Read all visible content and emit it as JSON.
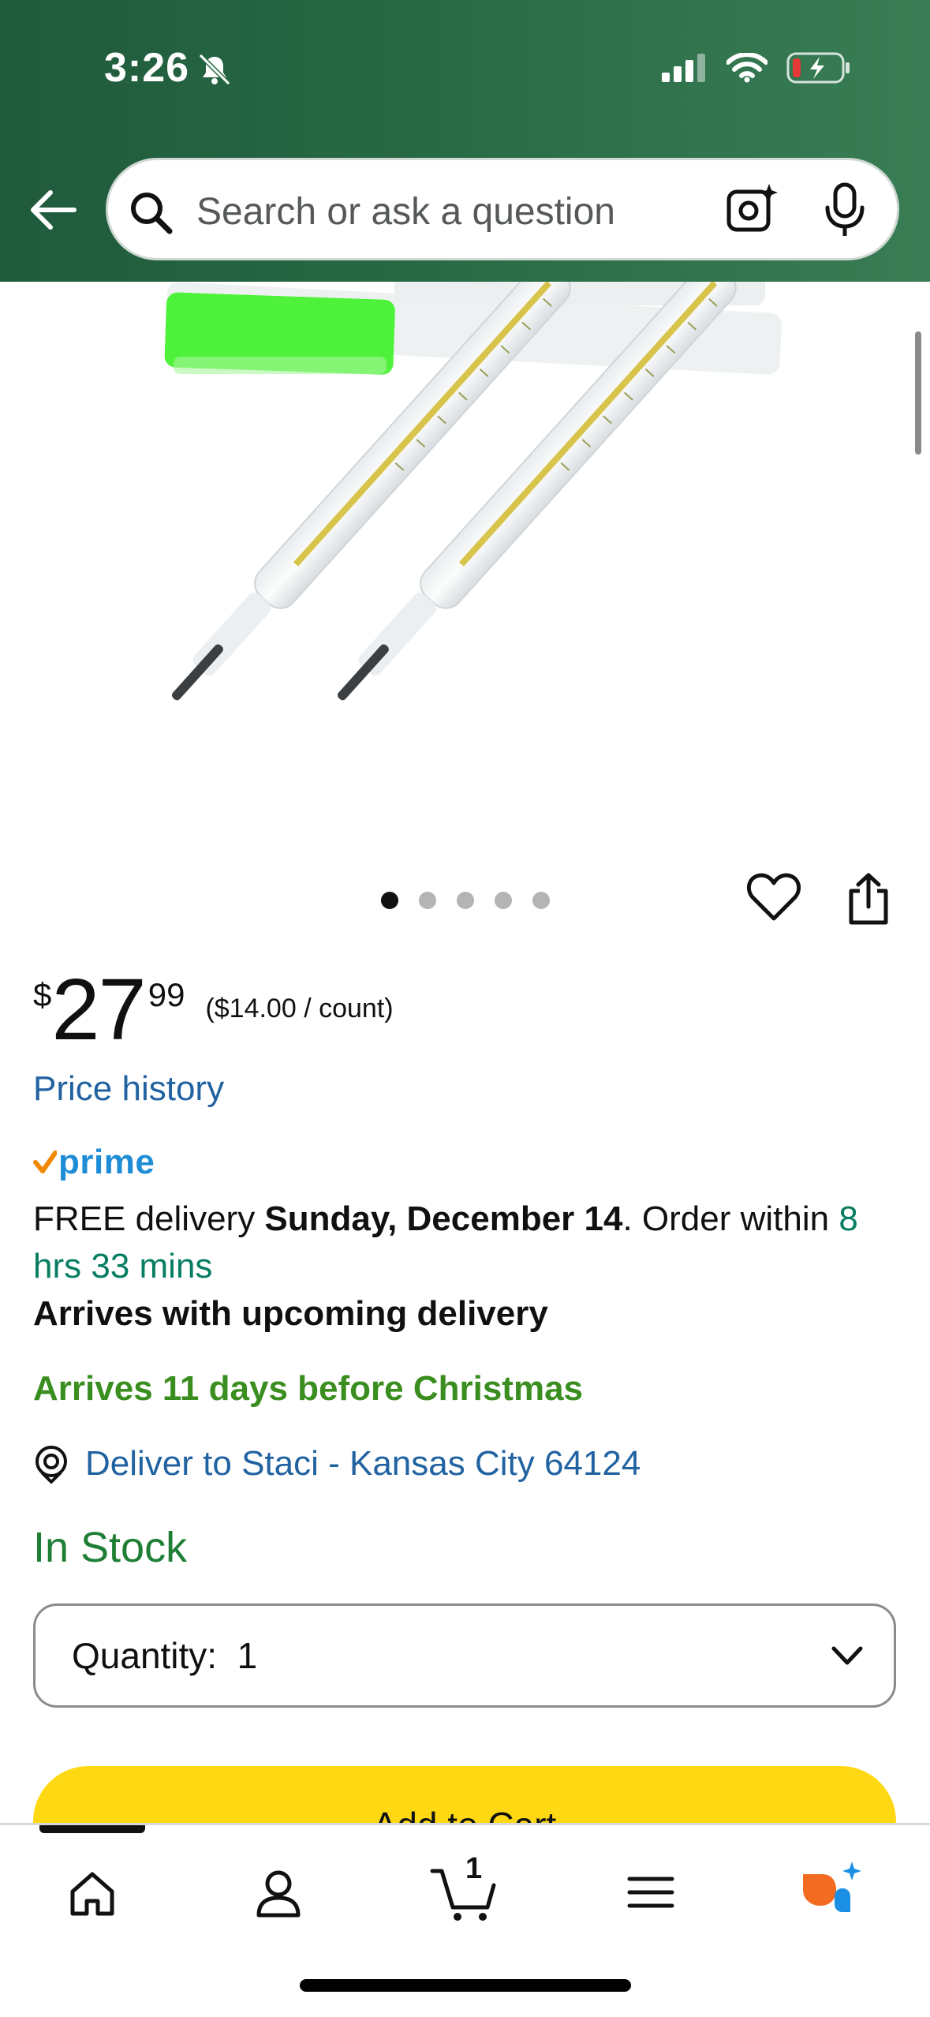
{
  "status_bar": {
    "time": "3:26"
  },
  "search": {
    "placeholder": "Search or ask a question"
  },
  "gallery": {
    "dots": 5,
    "active_index": 0
  },
  "price": {
    "currency": "$",
    "whole": "27",
    "fraction": "99",
    "unit_price": "($14.00 / count)"
  },
  "price_history": "Price history",
  "prime_label": "prime",
  "delivery": {
    "prefix": "FREE delivery ",
    "date": "Sunday, December 14",
    "middle": ". Order within ",
    "countdown": "8 hrs 33 mins"
  },
  "arrives_upcoming": "Arrives with upcoming delivery",
  "christmas_note": "Arrives 11 days before Christmas",
  "deliver_to": "Deliver to Staci - Kansas City 64124",
  "stock": "In Stock",
  "quantity": {
    "label": "Quantity:",
    "value": "1"
  },
  "add_to_cart": "Add to Cart",
  "tabbar": {
    "cart_count": "1",
    "tabs": [
      "home",
      "account",
      "cart",
      "menu",
      "rufus"
    ]
  },
  "colors": {
    "header": "#2a6d47",
    "link": "#2162a1",
    "stock": "#1e7e34",
    "christmas": "#3a8e1f",
    "add_to_cart": "#ffd814",
    "prime_blue": "#1f8dd6",
    "prime_check": "#f08804"
  }
}
